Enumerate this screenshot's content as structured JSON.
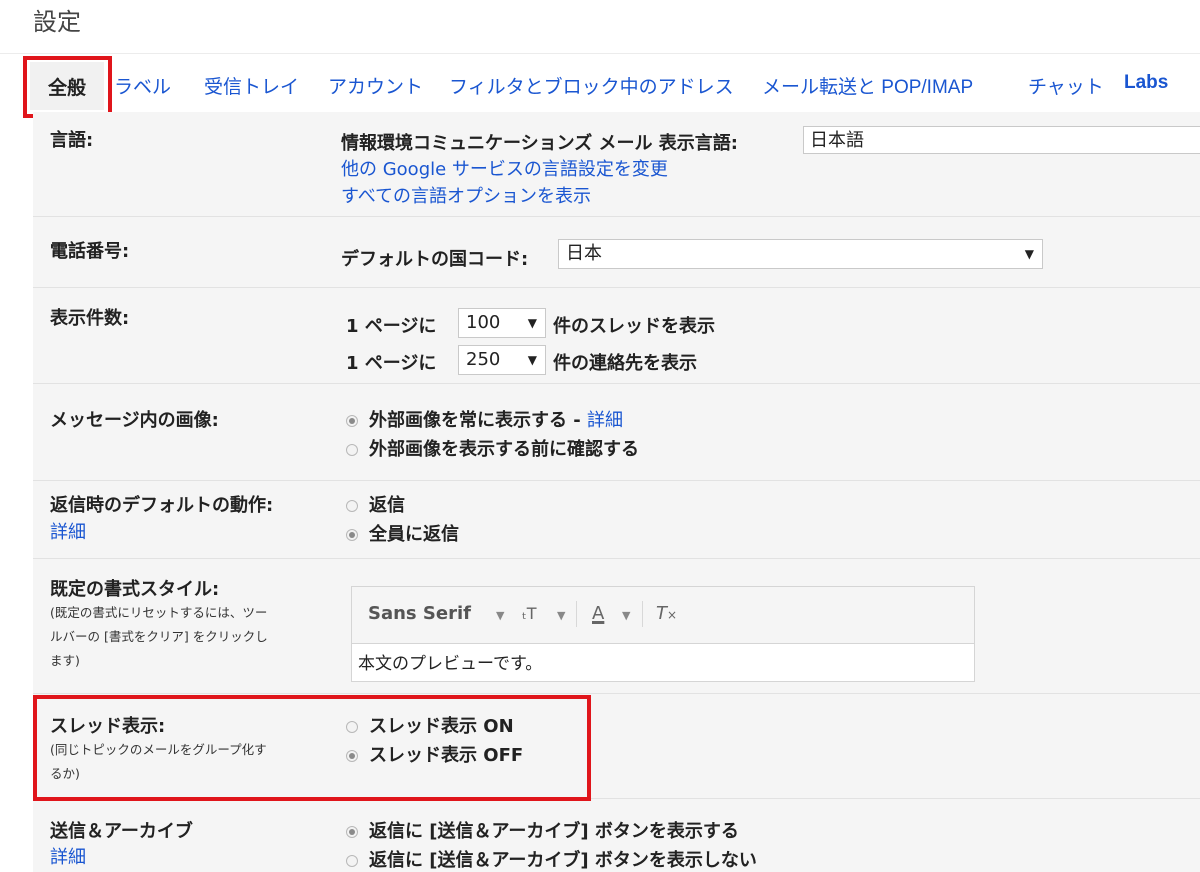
{
  "page": {
    "title": "設定"
  },
  "tabs": [
    {
      "label": "全般",
      "active": true
    },
    {
      "label": "ラベル"
    },
    {
      "label": "受信トレイ"
    },
    {
      "label": "アカウント"
    },
    {
      "label": "フィルタとブロック中のアドレス"
    },
    {
      "label": "メール転送と POP/IMAP"
    },
    {
      "label": "チャット"
    },
    {
      "label": "Labs"
    }
  ],
  "colors": {
    "link": "#1a56d1",
    "highlight": "#e0151b",
    "row_bg": "#f5f5f5"
  },
  "language": {
    "label": "言語:",
    "display_label": "情報環境コミュニケーションズ メール 表示言語:",
    "value": "日本語",
    "link1": "他の Google サービスの言語設定を変更",
    "link2": "すべての言語オプションを表示"
  },
  "phone": {
    "label": "電話番号:",
    "country_label": "デフォルトの国コード:",
    "country_value": "日本"
  },
  "page_size": {
    "label": "表示件数:",
    "prefix": "1 ページに",
    "threads_value": "100",
    "threads_suffix": "件のスレッドを表示",
    "contacts_value": "250",
    "contacts_suffix": "件の連絡先を表示"
  },
  "images": {
    "label": "メッセージ内の画像:",
    "option1": "外部画像を常に表示する - ",
    "option1_link": "詳細",
    "option2": "外部画像を表示する前に確認する"
  },
  "reply": {
    "label": "返信時のデフォルトの動作:",
    "label_link": "詳細",
    "option1": "返信",
    "option2": "全員に返信"
  },
  "text_style": {
    "label": "既定の書式スタイル:",
    "note_line1": "(既定の書式にリセットするには、ツー",
    "note_line2": "ルバーの [書式をクリア] をクリックし",
    "note_line3": "ます)",
    "font": "Sans Serif",
    "preview": "本文のプレビューです。",
    "icons": [
      "font-size-icon",
      "text-color-icon",
      "clear-format-icon"
    ]
  },
  "threading": {
    "label": "スレッド表示:",
    "note_line1": "(同じトピックのメールをグループ化す",
    "note_line2": "るか)",
    "option_on": "スレッド表示 ON",
    "option_off": "スレッド表示 OFF"
  },
  "send_archive": {
    "label": "送信＆アーカイブ",
    "label_link": "詳細",
    "option1": "返信に [送信＆アーカイブ] ボタンを表示する",
    "option2": "返信に [送信＆アーカイブ] ボタンを表示しない"
  }
}
